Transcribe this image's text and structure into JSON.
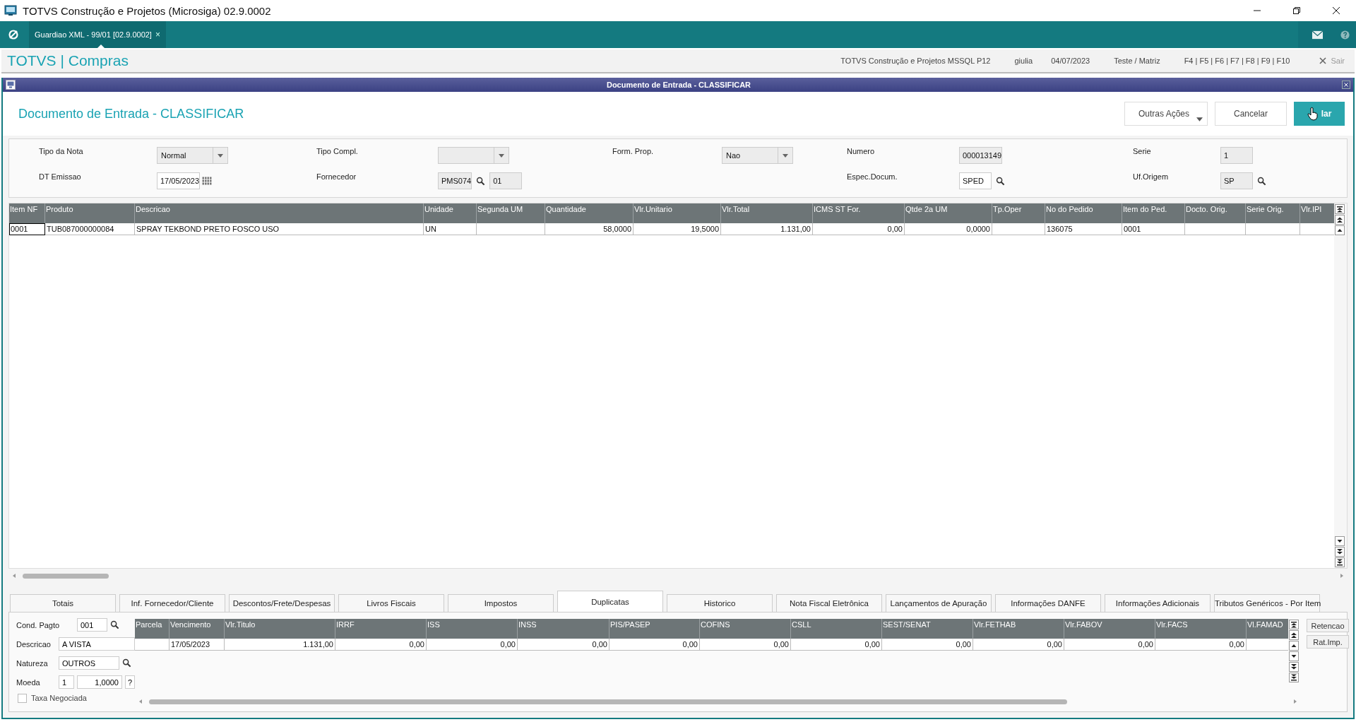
{
  "window": {
    "title": "TOTVS Construção e Projetos (Microsiga) 02.9.0002"
  },
  "tabbar": {
    "tabs": [
      {
        "label": "Guardiao XML - 99/01 [02.9.0002]",
        "close": "×",
        "selected": true
      }
    ]
  },
  "module_bar": {
    "title": "TOTVS | Compras",
    "info": [
      "TOTVS Construção e Projetos MSSQL P12",
      "giulia",
      "04/07/2023",
      "Teste / Matriz",
      "F4 | F5 | F6 | F7 | F8 | F9 | F10"
    ],
    "exit": "Sair"
  },
  "dialog": {
    "title": "Documento de Entrada - CLASSIFICAR",
    "heading": "Documento de Entrada - CLASSIFICAR",
    "buttons": [
      {
        "label": "Outras Ações",
        "kind": "menu"
      },
      {
        "label": "Cancelar",
        "kind": "default"
      },
      {
        "label": "lar",
        "kind": "primary"
      }
    ]
  },
  "header_form": {
    "rows": [
      [
        {
          "label": "Tipo da Nota",
          "inputs": [
            {
              "value": "Normal",
              "kind": "select",
              "disabled": true
            }
          ]
        },
        {
          "label": "Tipo Compl.",
          "inputs": [
            {
              "kind": "select",
              "disabled": true
            }
          ]
        },
        {
          "label": "Form. Prop.",
          "inputs": [
            {
              "value": "Nao",
              "kind": "select",
              "disabled": true
            }
          ]
        },
        {
          "label": "Numero",
          "inputs": [
            {
              "value": "000013149",
              "kind": "text",
              "disabled": true
            }
          ]
        },
        {
          "label": "Serie",
          "inputs": [
            {
              "value": "1",
              "kind": "text",
              "disabled": true
            }
          ]
        }
      ],
      [
        {
          "label": "DT Emissao",
          "inputs": [
            {
              "value": "17/05/2023",
              "kind": "date",
              "disabled": false
            }
          ]
        },
        {
          "label": "Fornecedor",
          "inputs": [
            {
              "value": "PMS074",
              "kind": "lookup",
              "disabled": true
            },
            {
              "value": "01",
              "kind": "text",
              "disabled": true
            }
          ]
        },
        null,
        {
          "label": "Espec.Docum.",
          "inputs": [
            {
              "value": "SPED",
              "kind": "lookup",
              "disabled": false
            }
          ]
        },
        {
          "label": "Uf.Origem",
          "inputs": [
            {
              "value": "SP",
              "kind": "lookup",
              "disabled": true
            }
          ]
        }
      ]
    ]
  },
  "items_table": {
    "columns": [
      "Item NF",
      "Produto",
      "Descricao",
      "Unidade",
      "Segunda UM",
      "Quantidade",
      "Vlr.Unitario",
      "Vlr.Total",
      "ICMS ST For.",
      "Qtde 2a UM",
      "Tp.Oper",
      "No do Pedido",
      "Item do Ped.",
      "Docto. Orig.",
      "Serie Orig.",
      "Vlr.IPI"
    ],
    "rows": [
      {
        "selected": true,
        "cells": [
          "0001",
          "TUB087000000084",
          "SPRAY TEKBOND PRETO FOSCO USO",
          "UN",
          "",
          "58,0000",
          "19,5000",
          "1.131,00",
          "0,00",
          "0,0000",
          "",
          "136075",
          "0001",
          "",
          "",
          ""
        ]
      }
    ]
  },
  "bottom_tabs": [
    {
      "label": "Totais",
      "selected": false
    },
    {
      "label": "Inf. Fornecedor/Cliente",
      "selected": false
    },
    {
      "label": "Descontos/Frete/Despesas",
      "selected": false
    },
    {
      "label": "Livros Fiscais",
      "selected": false
    },
    {
      "label": "Impostos",
      "selected": false
    },
    {
      "label": "Duplicatas",
      "selected": true
    },
    {
      "label": "Historico",
      "selected": false
    },
    {
      "label": "Nota Fiscal Eletrônica",
      "selected": false
    },
    {
      "label": "Lançamentos de Apuração",
      "selected": false
    },
    {
      "label": "Informações DANFE",
      "selected": false
    },
    {
      "label": "Informações Adicionais",
      "selected": false
    },
    {
      "label": "Tributos Genéricos - Por Item",
      "selected": false
    }
  ],
  "duplicatas": {
    "fields": [
      {
        "label": "Cond. Pagto",
        "inputs": [
          {
            "value": "001",
            "kind": "lookup"
          }
        ]
      },
      {
        "label": "Descricao",
        "inputs": [
          {
            "value": "A VISTA",
            "kind": "text"
          }
        ]
      },
      {
        "label": "Natureza",
        "inputs": [
          {
            "value": "OUTROS",
            "kind": "lookup"
          }
        ]
      },
      {
        "label": "Moeda",
        "inputs": [
          {
            "value": "1",
            "kind": "text"
          },
          {
            "value": "1,0000",
            "kind": "help",
            "help": "?"
          }
        ]
      }
    ],
    "checkbox": {
      "label": "Taxa Negociada",
      "checked": false
    },
    "table": {
      "columns": [
        "Parcela",
        "Vencimento",
        "Vlr.Titulo",
        "IRRF",
        "ISS",
        "INSS",
        "PIS/PASEP",
        "COFINS",
        "CSLL",
        "SEST/SENAT",
        "Vlr.FETHAB",
        "Vlr.FABOV",
        "Vlr.FACS",
        "Vl.FAMAD"
      ],
      "rows": [
        [
          "",
          "17/05/2023",
          "1.131,00",
          "0,00",
          "0,00",
          "0,00",
          "0,00",
          "0,00",
          "0,00",
          "0,00",
          "0,00",
          "0,00",
          "0,00",
          ""
        ]
      ]
    },
    "buttons": [
      "Retencao",
      "Rat.Imp."
    ]
  }
}
